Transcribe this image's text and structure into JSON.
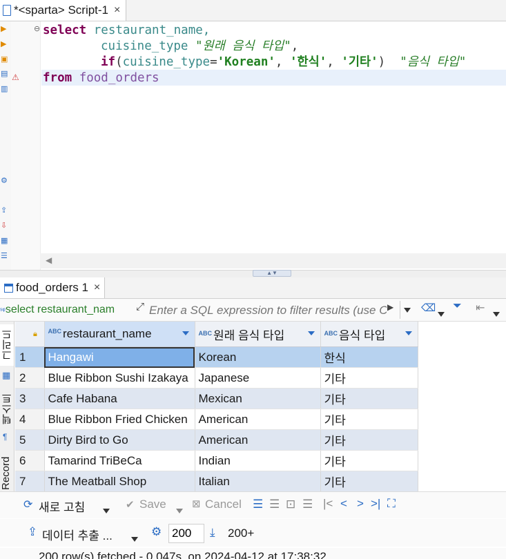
{
  "editor": {
    "tab_label": "*<sparta> Script-1",
    "close_glyph": "×",
    "code": {
      "line1": {
        "kw": "select",
        "rest": " restaurant_name,"
      },
      "line2": {
        "ident": "cuisine_type",
        "alias": "\"원래 음식 타입\"",
        "comma": ","
      },
      "line3": {
        "kw": "if",
        "open": "(",
        "ident": "cuisine_type",
        "eq": "=",
        "lit1": "'Korean'",
        "sep1": ", ",
        "lit2": "'한식'",
        "sep2": ", ",
        "lit3": "'기타'",
        "close": ")",
        "alias": "\"음식 타입\""
      },
      "line4": {
        "kw": "from",
        "table": "food_orders"
      }
    }
  },
  "results": {
    "tab_label": "food_orders 1",
    "close_glyph": "×",
    "query_preview": "select restaurant_nam",
    "filter_placeholder": "Enter a SQL expression to filter results (use Ctrl+Space)",
    "side_tabs": {
      "grid": "그리드",
      "text": "텍스트",
      "record": "Record"
    },
    "columns": [
      "restaurant_name",
      "원래 음식 타입",
      "음식 타입"
    ],
    "column_type_badge": "ABC",
    "rows": [
      {
        "n": "1",
        "cells": [
          "Hangawi",
          "Korean",
          "한식"
        ]
      },
      {
        "n": "2",
        "cells": [
          "Blue Ribbon Sushi Izakaya",
          "Japanese",
          "기타"
        ]
      },
      {
        "n": "3",
        "cells": [
          "Cafe Habana",
          "Mexican",
          "기타"
        ]
      },
      {
        "n": "4",
        "cells": [
          "Blue Ribbon Fried Chicken",
          "American",
          "기타"
        ]
      },
      {
        "n": "5",
        "cells": [
          "Dirty Bird to Go",
          "American",
          "기타"
        ]
      },
      {
        "n": "6",
        "cells": [
          "Tamarind TriBeCa",
          "Indian",
          "기타"
        ]
      },
      {
        "n": "7",
        "cells": [
          "The Meatball Shop",
          "Italian",
          "기타"
        ]
      }
    ]
  },
  "toolbar": {
    "refresh_label": "새로 고침",
    "save_label": "Save",
    "cancel_label": "Cancel",
    "export_label": "데이터 추출 ...",
    "fetch_size": "200",
    "fetch_more_label": "200+"
  },
  "status": {
    "text": "200 row(s) fetched - 0.047s, on 2024-04-12 at 17:38:32"
  },
  "colors": {
    "keyword": "#7f0055",
    "identifier": "#3a8a8a",
    "string": "#2a7f2a",
    "selection": "#b7d2ef",
    "accent": "#2b6cc4"
  }
}
